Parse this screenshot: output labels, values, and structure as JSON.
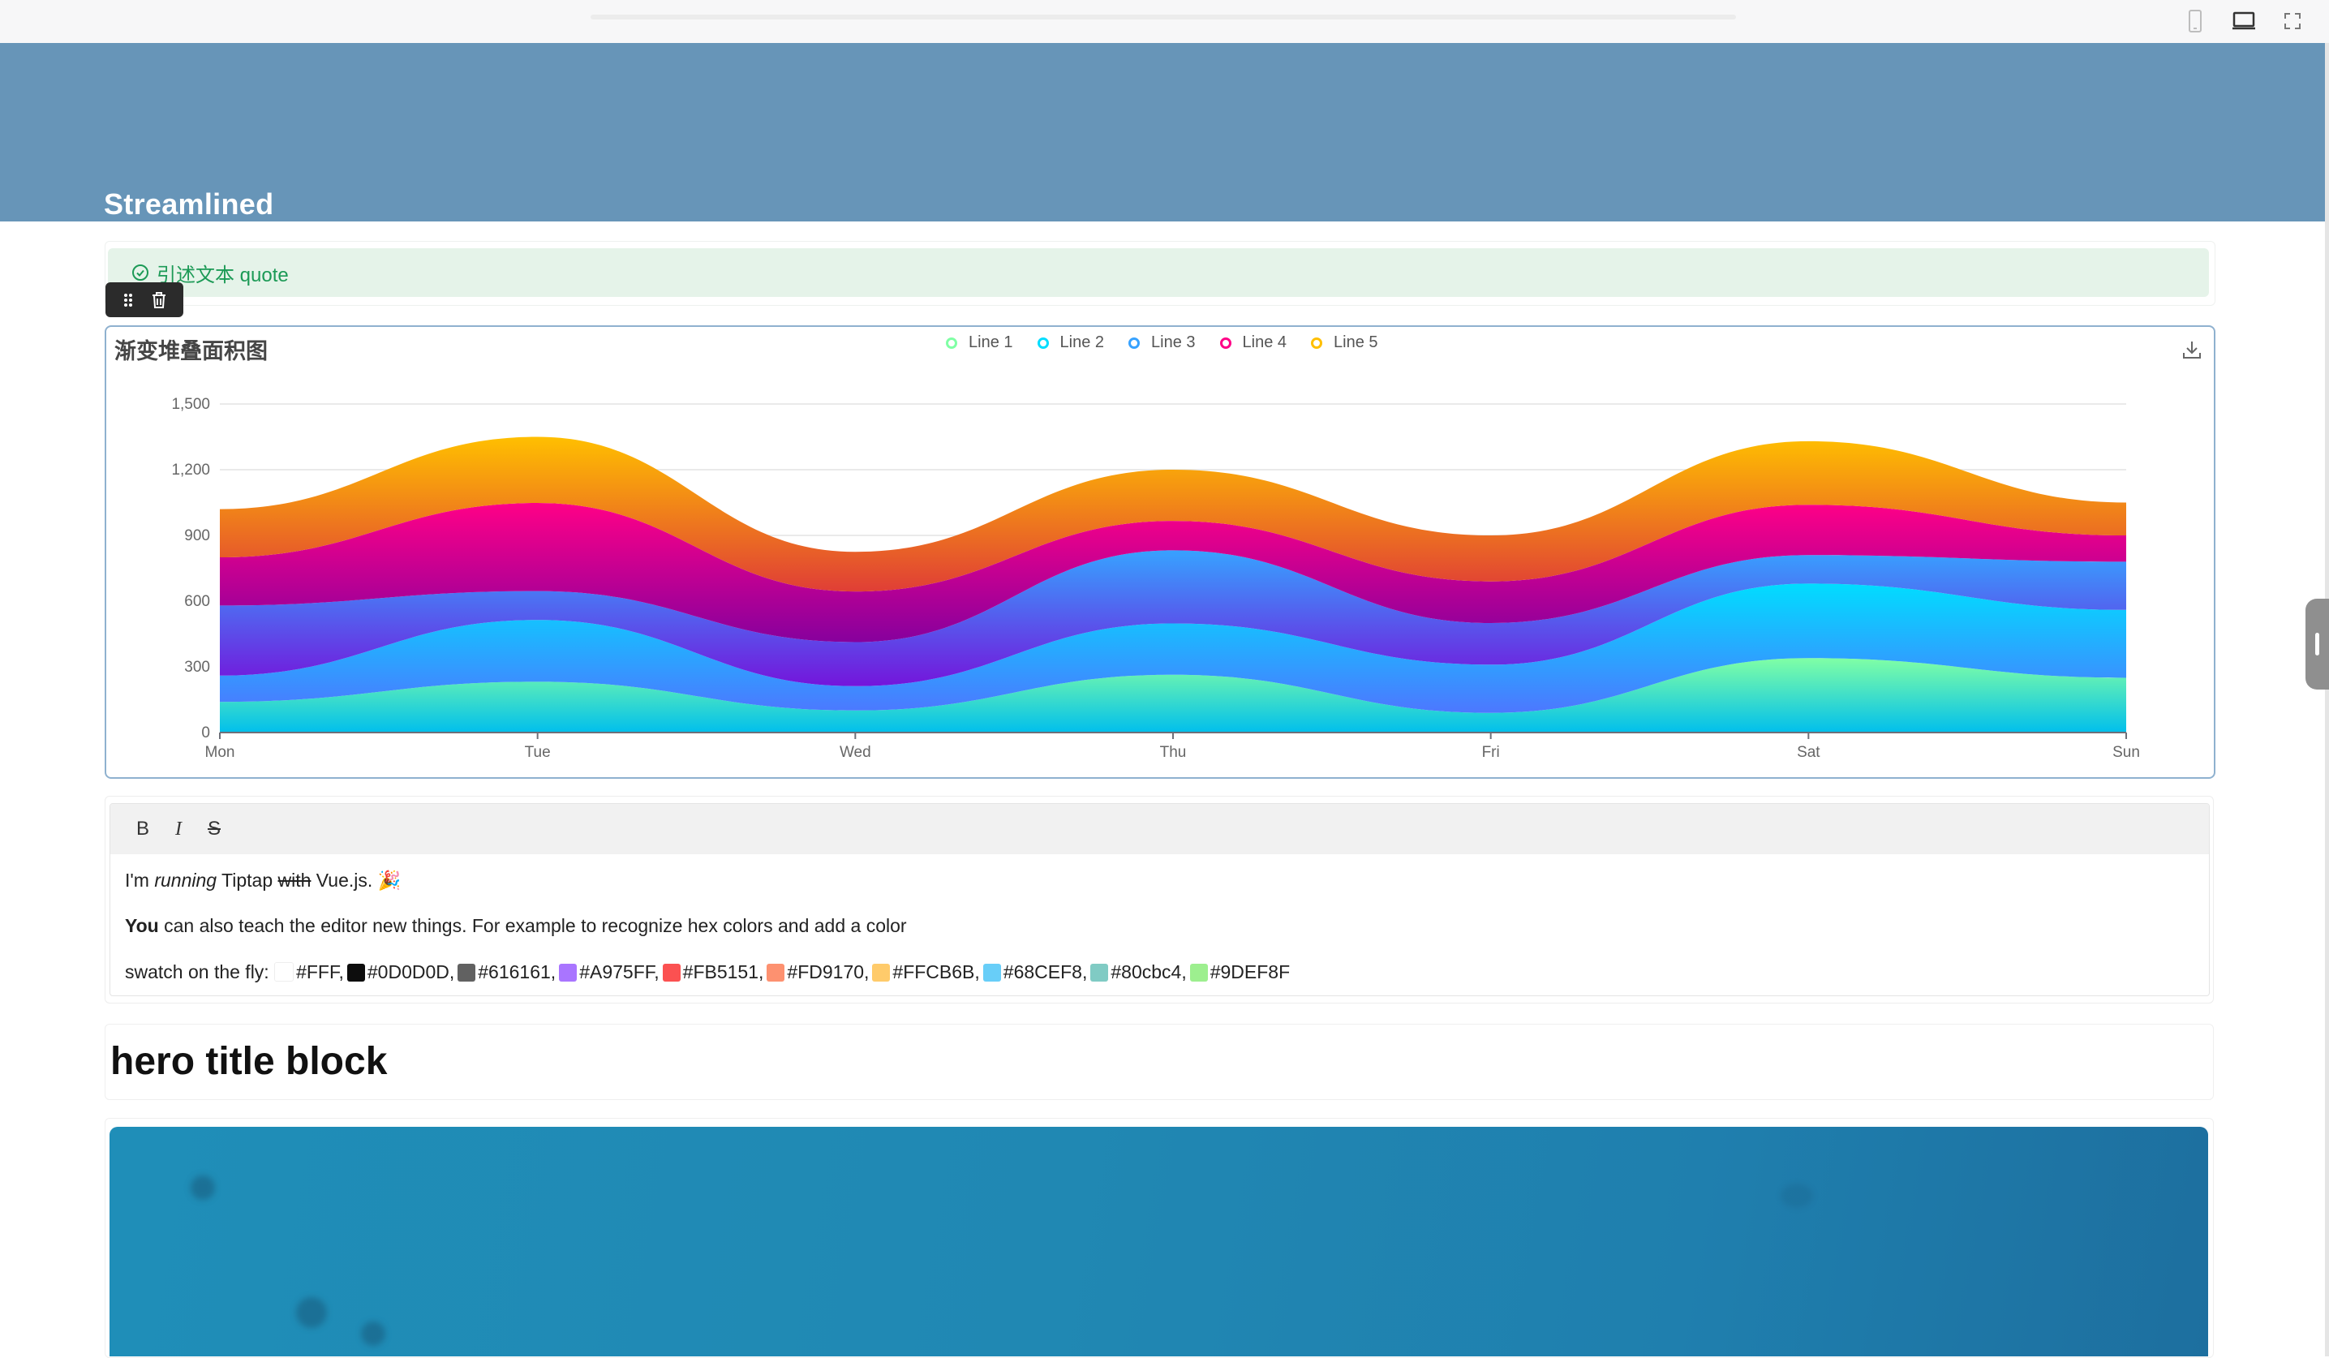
{
  "header": {
    "title": "Streamlined"
  },
  "quote": {
    "text": "引述文本 quote"
  },
  "chart_data": {
    "type": "area",
    "stacked": true,
    "title": "渐变堆叠面积图",
    "categories": [
      "Mon",
      "Tue",
      "Wed",
      "Thu",
      "Fri",
      "Sat",
      "Sun"
    ],
    "ylim": [
      0,
      1500
    ],
    "yticks": [
      "0",
      "300",
      "600",
      "900",
      "1,200",
      "1,500"
    ],
    "grid": true,
    "legend_position": "top-center",
    "series": [
      {
        "name": "Line 1",
        "values": [
          140,
          232,
          101,
          264,
          90,
          340,
          250
        ],
        "color_from": "#80FFA5",
        "color_to": "#01BFEC"
      },
      {
        "name": "Line 2",
        "values": [
          120,
          282,
          111,
          234,
          220,
          340,
          310
        ],
        "color_from": "#00DDFF",
        "color_to": "#4D77FF"
      },
      {
        "name": "Line 3",
        "values": [
          320,
          132,
          201,
          334,
          190,
          130,
          220
        ],
        "color_from": "#37A2FF",
        "color_to": "#7415DB"
      },
      {
        "name": "Line 4",
        "values": [
          220,
          402,
          231,
          134,
          190,
          230,
          120
        ],
        "color_from": "#FF0087",
        "color_to": "#87009D"
      },
      {
        "name": "Line 5",
        "values": [
          220,
          302,
          181,
          234,
          210,
          290,
          150
        ],
        "color_from": "#FFBF00",
        "color_to": "#E03E36"
      }
    ]
  },
  "editor": {
    "toolbar": {
      "bold": "B",
      "italic": "I",
      "strike": "S"
    },
    "line1": {
      "pre": "I'm ",
      "italic": "running",
      "mid": " Tiptap ",
      "strike": "with",
      "post": " Vue.js. 🎉"
    },
    "line2": {
      "bold": "You",
      "rest": " can also teach the editor new things. For example to recognize hex colors and add a color"
    },
    "line3_prefix": "swatch on the fly: ",
    "swatches": [
      {
        "label": "#FFF,",
        "color": "#FFFFFF"
      },
      {
        "label": "#0D0D0D,",
        "color": "#0D0D0D"
      },
      {
        "label": "#616161,",
        "color": "#616161"
      },
      {
        "label": "#A975FF,",
        "color": "#A975FF"
      },
      {
        "label": "#FB5151,",
        "color": "#FB5151"
      },
      {
        "label": "#FD9170,",
        "color": "#FD9170"
      },
      {
        "label": "#FFCB6B,",
        "color": "#FFCB6B"
      },
      {
        "label": "#68CEF8,",
        "color": "#68CEF8"
      },
      {
        "label": "#80cbc4,",
        "color": "#80cbc4"
      },
      {
        "label": "#9DEF8F",
        "color": "#9DEF8F"
      }
    ]
  },
  "hero": {
    "title": "hero title block"
  },
  "colors": {
    "banner": "#6795b8",
    "quote_bg": "#e5f3e9",
    "quote_text": "#1c9a56",
    "chart_border": "#8fb1cf"
  },
  "icons": {
    "mobile": "mobile-icon",
    "desktop": "desktop-icon",
    "fullscreen": "fullscreen-icon",
    "drag": "drag-handle-icon",
    "delete": "trash-icon",
    "download": "download-icon",
    "check": "check-circle-icon"
  }
}
